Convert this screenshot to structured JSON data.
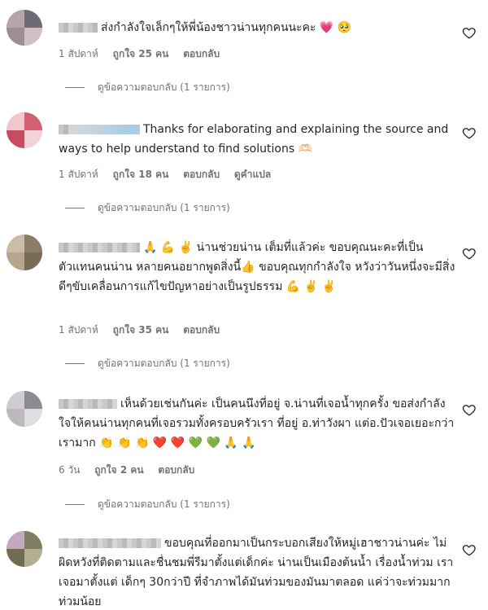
{
  "comments": [
    {
      "text": "ส่งกำลังใจเล็กๆให้พี่น้องชาวน่านทุกคนนะคะ 💗 🥺",
      "time": "1 สัปดาห์",
      "likes": "ถูกใจ 25 คน",
      "reply": "ตอบกลับ",
      "translate": "",
      "view_replies": "ดูข้อความตอบกลับ (1 รายการ)"
    },
    {
      "text": "Thanks for elaborating and explaining the source and ways to help understand to find solutions 🫶🏻",
      "time": "1 สัปดาห์",
      "likes": "ถูกใจ 18 คน",
      "reply": "ตอบกลับ",
      "translate": "ดูคำแปล",
      "view_replies": "ดูข้อความตอบกลับ (1 รายการ)"
    },
    {
      "text": "🙏 💪 ✌️ น่านช่วยน่าน เต็มที่แล้วค่ะ ขอบคุณนะคะที่เป็นตัวแทนคนน่าน หลายคนอยากพูดสิ่งนี้👍 ขอบคุณทุกกำลังใจ หวังว่าวันหนึ่งจะมีสิ่งดีๆขับเคลื่อนการแก้ไขปัญหาอย่างเป็นรูปธรรม 💪 ✌️ ✌️",
      "time": "1 สัปดาห์",
      "likes": "ถูกใจ 35 คน",
      "reply": "ตอบกลับ",
      "translate": "",
      "view_replies": "ดูข้อความตอบกลับ (1 รายการ)"
    },
    {
      "text": "เห็นด้วยเช่นกันค่ะ เป็นคนนึงที่อยู่ จ.น่านที่เจอน้ำทุกครั้ง ขอส่งกำลังใจให้คนน่านทุกคนที่เจอรวมทั้งครอบครัวเรา ที่อยู่ อ.ท่าวังผา แต่อ.ปัวเจอเยอะกว่าเรามาก 👏 👏 👏 ❤️ ❤️ 💚 💚 🙏 🙏",
      "time": "6 วัน",
      "likes": "ถูกใจ 2 คน",
      "reply": "ตอบกลับ",
      "translate": "",
      "view_replies": "ดูข้อความตอบกลับ (1 รายการ)"
    },
    {
      "text": "ขอบคุณที่ออกมาเป็นกระบอกเสียงให้หมู่เฮาชาวน่านค่ะ ไม่ผิดหวังที่ติดตามและชื่นชมพี่รีมาตั้งแต่เด็กค่ะ น่านเป็นเมืองต้นน้ำ เรื่องน้ำท่วม เราเจอมาตั้งแต่ เด็กๆ 30กว่าปี ที่จำภาพได้มันท่วมของมันมาตลอด แค่ว่าจะท่วมมากท่วมน้อย",
      "time": "",
      "likes": "",
      "reply": "",
      "translate": "",
      "view_replies": ""
    }
  ],
  "icons": {
    "like": "heart-outline-icon"
  },
  "colors": {
    "text": "#262626",
    "secondary": "#737373"
  }
}
